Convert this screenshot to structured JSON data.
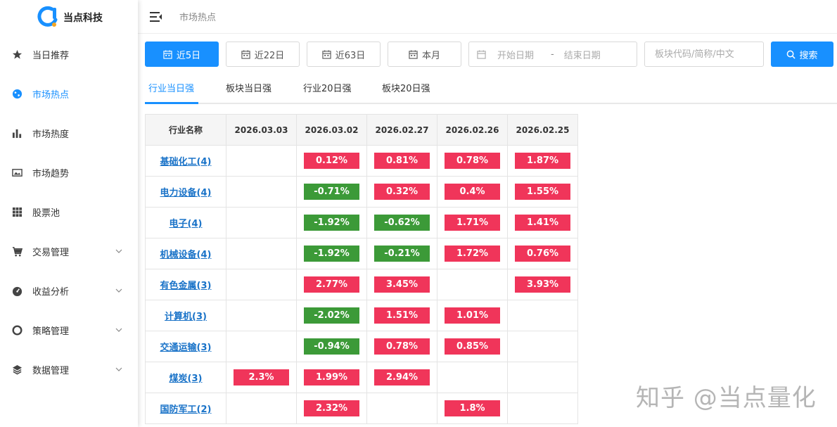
{
  "app": {
    "logo_text": "当点科技",
    "brand_color": "#1890ff"
  },
  "sidebar": {
    "items": [
      {
        "label": "当日推荐",
        "icon": "star-icon",
        "active": false,
        "has_submenu": false
      },
      {
        "label": "市场热点",
        "icon": "globe-icon",
        "active": true,
        "has_submenu": false
      },
      {
        "label": "市场热度",
        "icon": "bar-chart-icon",
        "active": false,
        "has_submenu": false
      },
      {
        "label": "市场趋势",
        "icon": "image-icon",
        "active": false,
        "has_submenu": false
      },
      {
        "label": "股票池",
        "icon": "grid-icon",
        "active": false,
        "has_submenu": false
      },
      {
        "label": "交易管理",
        "icon": "cart-icon",
        "active": false,
        "has_submenu": true
      },
      {
        "label": "收益分析",
        "icon": "dashboard-icon",
        "active": false,
        "has_submenu": true
      },
      {
        "label": "策略管理",
        "icon": "lifebuoy-icon",
        "active": false,
        "has_submenu": true
      },
      {
        "label": "数据管理",
        "icon": "layers-icon",
        "active": false,
        "has_submenu": true
      }
    ]
  },
  "header": {
    "breadcrumb": "市场热点"
  },
  "filters": {
    "periods": [
      "近5日",
      "近22日",
      "近63日",
      "本月"
    ],
    "active_period": "近5日",
    "date_start_placeholder": "开始日期",
    "date_separator": "-",
    "date_end_placeholder": "结束日期",
    "search_placeholder": "板块代码/简称/中文",
    "search_label": "搜索"
  },
  "tabs": {
    "items": [
      "行业当日强",
      "板块当日强",
      "行业20日强",
      "板块20日强"
    ],
    "active": "行业当日强"
  },
  "table": {
    "columns": [
      "行业名称",
      "2026.03.03",
      "2026.03.02",
      "2026.02.27",
      "2026.02.26",
      "2026.02.25"
    ],
    "rows": [
      {
        "name": "基础化工(4)",
        "values": [
          "",
          "0.12%",
          "0.81%",
          "0.78%",
          "1.87%"
        ]
      },
      {
        "name": "电力设备(4)",
        "values": [
          "",
          "-0.71%",
          "0.32%",
          "0.4%",
          "1.55%"
        ]
      },
      {
        "name": "电子(4)",
        "values": [
          "",
          "-1.92%",
          "-0.62%",
          "1.71%",
          "1.41%"
        ]
      },
      {
        "name": "机械设备(4)",
        "values": [
          "",
          "-1.92%",
          "-0.21%",
          "1.72%",
          "0.76%"
        ]
      },
      {
        "name": "有色金属(3)",
        "values": [
          "",
          "2.77%",
          "3.45%",
          "",
          "3.93%"
        ]
      },
      {
        "name": "计算机(3)",
        "values": [
          "",
          "-2.02%",
          "1.51%",
          "1.01%",
          ""
        ]
      },
      {
        "name": "交通运输(3)",
        "values": [
          "",
          "-0.94%",
          "0.78%",
          "0.85%",
          ""
        ]
      },
      {
        "name": "煤炭(3)",
        "values": [
          "2.3%",
          "1.99%",
          "2.94%",
          "",
          ""
        ]
      },
      {
        "name": "国防军工(2)",
        "values": [
          "",
          "2.32%",
          "",
          "1.8%",
          ""
        ]
      }
    ],
    "up_color": "#f0355a",
    "down_color": "#3c9a38"
  },
  "watermark": "知乎 @当点量化"
}
